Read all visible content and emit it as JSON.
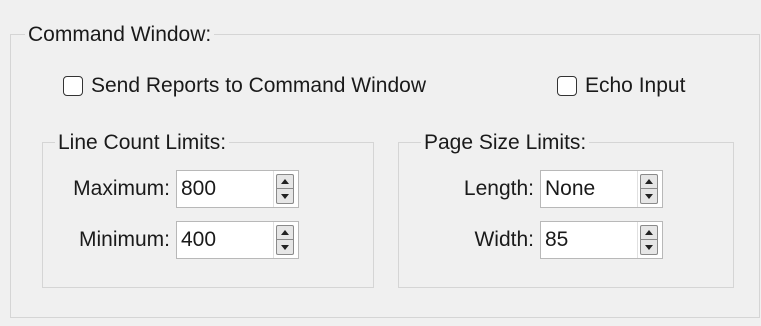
{
  "command_window": {
    "title": "Command Window:",
    "send_reports": {
      "label": "Send Reports to Command Window",
      "checked": false
    },
    "echo_input": {
      "label": "Echo Input",
      "checked": false
    },
    "line_count_limits": {
      "title": "Line Count Limits:",
      "maximum": {
        "label": "Maximum:",
        "value": "800"
      },
      "minimum": {
        "label": "Minimum:",
        "value": "400"
      }
    },
    "page_size_limits": {
      "title": "Page Size Limits:",
      "length": {
        "label": "Length:",
        "value": "None"
      },
      "width": {
        "label": "Width:",
        "value": "85"
      }
    }
  },
  "icons": {
    "spin_up": "triangle-up",
    "spin_down": "triangle-down"
  }
}
